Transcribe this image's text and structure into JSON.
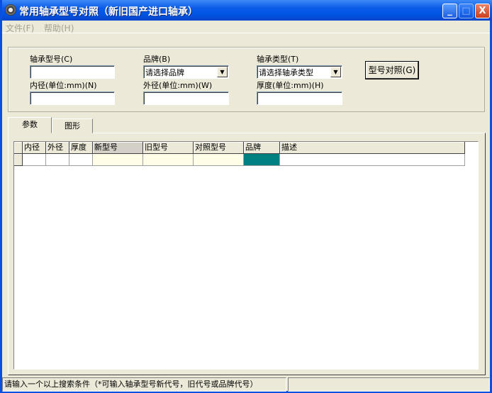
{
  "window": {
    "title": "常用轴承型号对照（新旧国产进口轴承）",
    "minimize": "_",
    "maximize": "□",
    "close": "X"
  },
  "menu": [
    {
      "label": "文件(F)"
    },
    {
      "label": "帮助(H)"
    }
  ],
  "form": {
    "model_label": "轴承型号(C)",
    "model_value": "",
    "brand_label": "品牌(B)",
    "brand_value": "请选择品牌",
    "type_label": "轴承类型(T)",
    "type_value": "请选择轴承类型",
    "inner_label": "内径(单位:mm)(N)",
    "inner_value": "",
    "outer_label": "外径(单位:mm)(W)",
    "outer_value": "",
    "thick_label": "厚度(单位:mm)(H)",
    "thick_value": "",
    "compare_button": "型号对照(G)"
  },
  "tabs": [
    {
      "label": "参数",
      "active": true
    },
    {
      "label": "图形",
      "active": false
    }
  ],
  "grid": {
    "columns": [
      "内径",
      "外径",
      "厚度",
      "新型号",
      "旧型号",
      "对照型号",
      "品牌",
      "描述"
    ],
    "rows": [
      [
        "",
        "",
        "",
        "",
        "",
        "",
        "",
        ""
      ]
    ]
  },
  "colors": {
    "brand_cell": "#008080",
    "highlight_cell": "#fffde8"
  },
  "status": {
    "message": "请输入一个以上搜索条件（*可输入轴承型号新代号，旧代号或品牌代号）",
    "secondary": ""
  }
}
